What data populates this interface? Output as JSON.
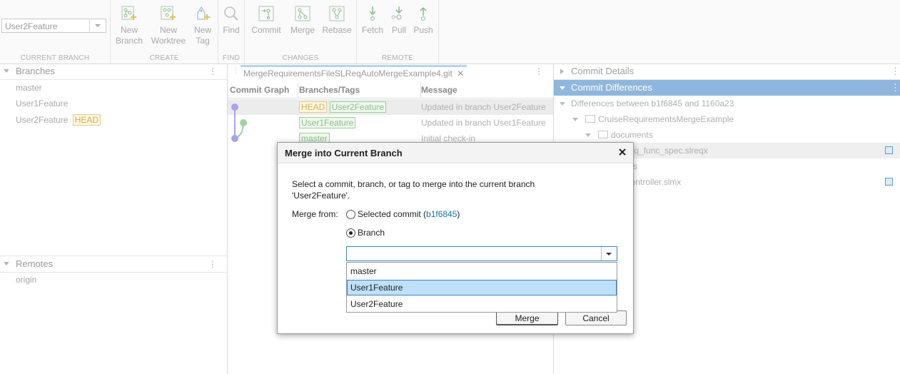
{
  "toolstrip": {
    "current_branch": {
      "value": "User2Feature",
      "section_label": "CURRENT BRANCH"
    },
    "create": {
      "section_label": "CREATE",
      "new_branch": [
        "New",
        "Branch"
      ],
      "new_worktree": [
        "New",
        "Worktree"
      ],
      "new_tag": [
        "New",
        "Tag"
      ]
    },
    "find": {
      "section_label": "FIND",
      "find": "Find"
    },
    "changes": {
      "section_label": "CHANGES",
      "commit": "Commit",
      "merge": "Merge",
      "rebase": "Rebase"
    },
    "remote": {
      "section_label": "REMOTE",
      "fetch": "Fetch",
      "pull": "Pull",
      "push": "Push"
    }
  },
  "branches_panel": {
    "title": "Branches",
    "items": [
      "master",
      "User1Feature",
      "User2Feature"
    ],
    "head_badge": "HEAD"
  },
  "remotes_panel": {
    "title": "Remotes",
    "items": [
      "origin"
    ]
  },
  "log": {
    "tab_title": "MergeRequirementsFileSLReqAutoMergeExample4.git",
    "columns": {
      "graph": "Commit Graph",
      "branches": "Branches/Tags",
      "message": "Message"
    },
    "rows": [
      {
        "tags": [
          "HEAD",
          "User2Feature"
        ],
        "message": "Updated in branch User2Feature"
      },
      {
        "tags": [
          "User1Feature"
        ],
        "message": "Updated in branch User1Feature"
      },
      {
        "tags": [
          "master"
        ],
        "message": "Initial check-in"
      }
    ],
    "colors": {
      "graph_main": "#a9a2ef",
      "graph_branch": "#9ed39e"
    }
  },
  "details": {
    "commit_details": "Commit Details",
    "commit_differences": "Commit Differences",
    "differences_between": "Differences between b1f6845 and 1160a23",
    "tree": {
      "root": "CruiseRequirementsMergeExample",
      "documents": "documents",
      "file1": "_req_func_spec.slreqx",
      "partial": "s",
      "file2": "_controller.slmx"
    }
  },
  "dialog": {
    "title": "Merge into Current Branch",
    "instructions_line1": "Select a commit, branch, or tag to merge into the current branch",
    "instructions_line2": "'User2Feature'.",
    "merge_from_label": "Merge from:",
    "selected_commit_label": "Selected commit (",
    "selected_commit_hash": "b1f6845",
    "selected_commit_close": ")",
    "branch_label": "Branch",
    "combo_value": "",
    "options": [
      "master",
      "User1Feature",
      "User2Feature"
    ],
    "merge_button": "Merge",
    "cancel_button": "Cancel",
    "accent": "#3a83c9"
  }
}
